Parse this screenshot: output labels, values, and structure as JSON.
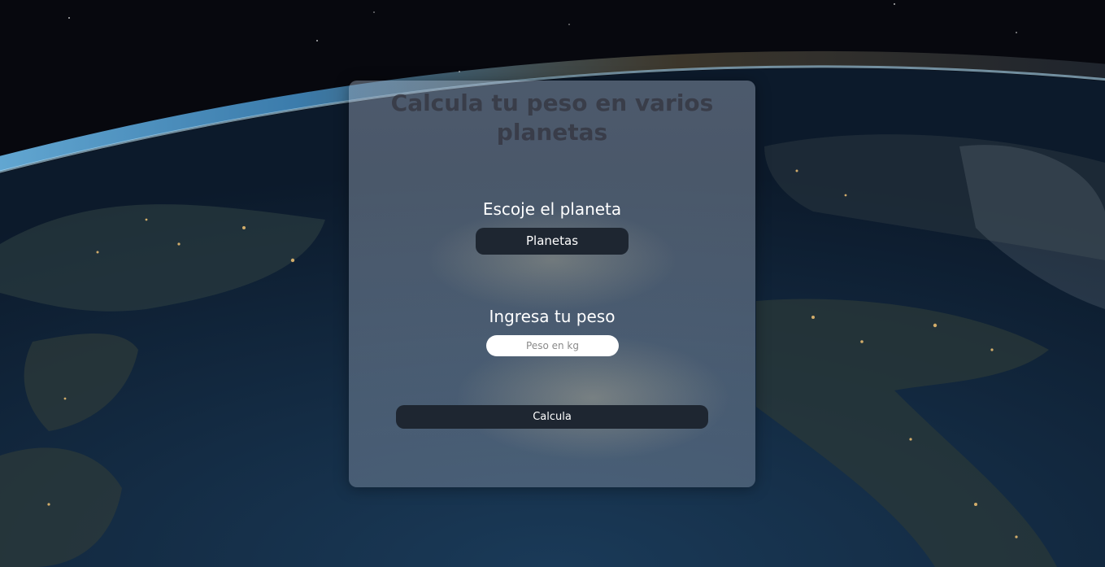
{
  "page": {
    "title": "Calcula tu peso en varios planetas"
  },
  "form": {
    "planet_label": "Escoje el planeta",
    "planet_select_value": "Planetas",
    "weight_label": "Ingresa tu peso",
    "weight_placeholder": "Peso en kg",
    "submit_label": "Calcula"
  },
  "colors": {
    "card_bg": "#bec8d7",
    "control_bg": "#1e2631",
    "text_light": "#ffffff",
    "title_text": "#32323c"
  }
}
